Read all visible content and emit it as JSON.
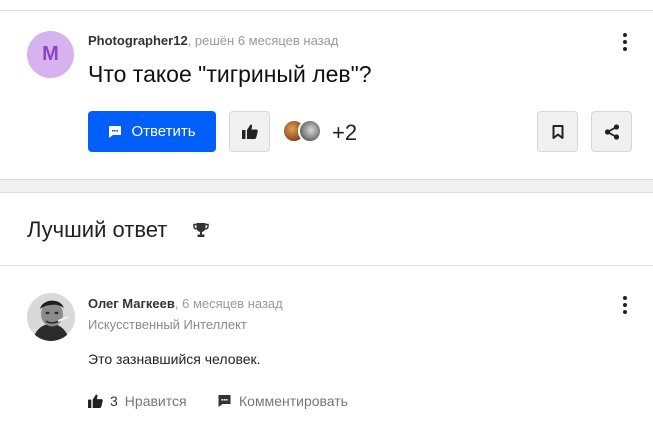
{
  "question": {
    "avatar_letter": "M",
    "author": "Photographer12",
    "meta": ", решён 6 месяцев назад",
    "title": "Что такое \"тигриный лев\"?",
    "answer_button": "Ответить",
    "extra_count": "+2"
  },
  "best_answer": {
    "heading": "Лучший ответ",
    "author": "Олег Магкеев",
    "meta": ", 6 месяцев назад",
    "role": "Искусственный Интеллект",
    "text": "Это зазнавшийся человек.",
    "likes_count": "3",
    "like_label": "Нравится",
    "comment_label": "Комментировать"
  },
  "icons": {
    "menu": "more-vertical-icon",
    "answer": "chat-icon",
    "like": "thumbs-up-icon",
    "bookmark": "bookmark-icon",
    "share": "share-icon",
    "trophy": "trophy-icon",
    "comment": "comment-icon"
  },
  "colors": {
    "primary": "#005ff9",
    "avatar_bg": "#d6b2ef",
    "avatar_fg": "#8a44c4"
  }
}
